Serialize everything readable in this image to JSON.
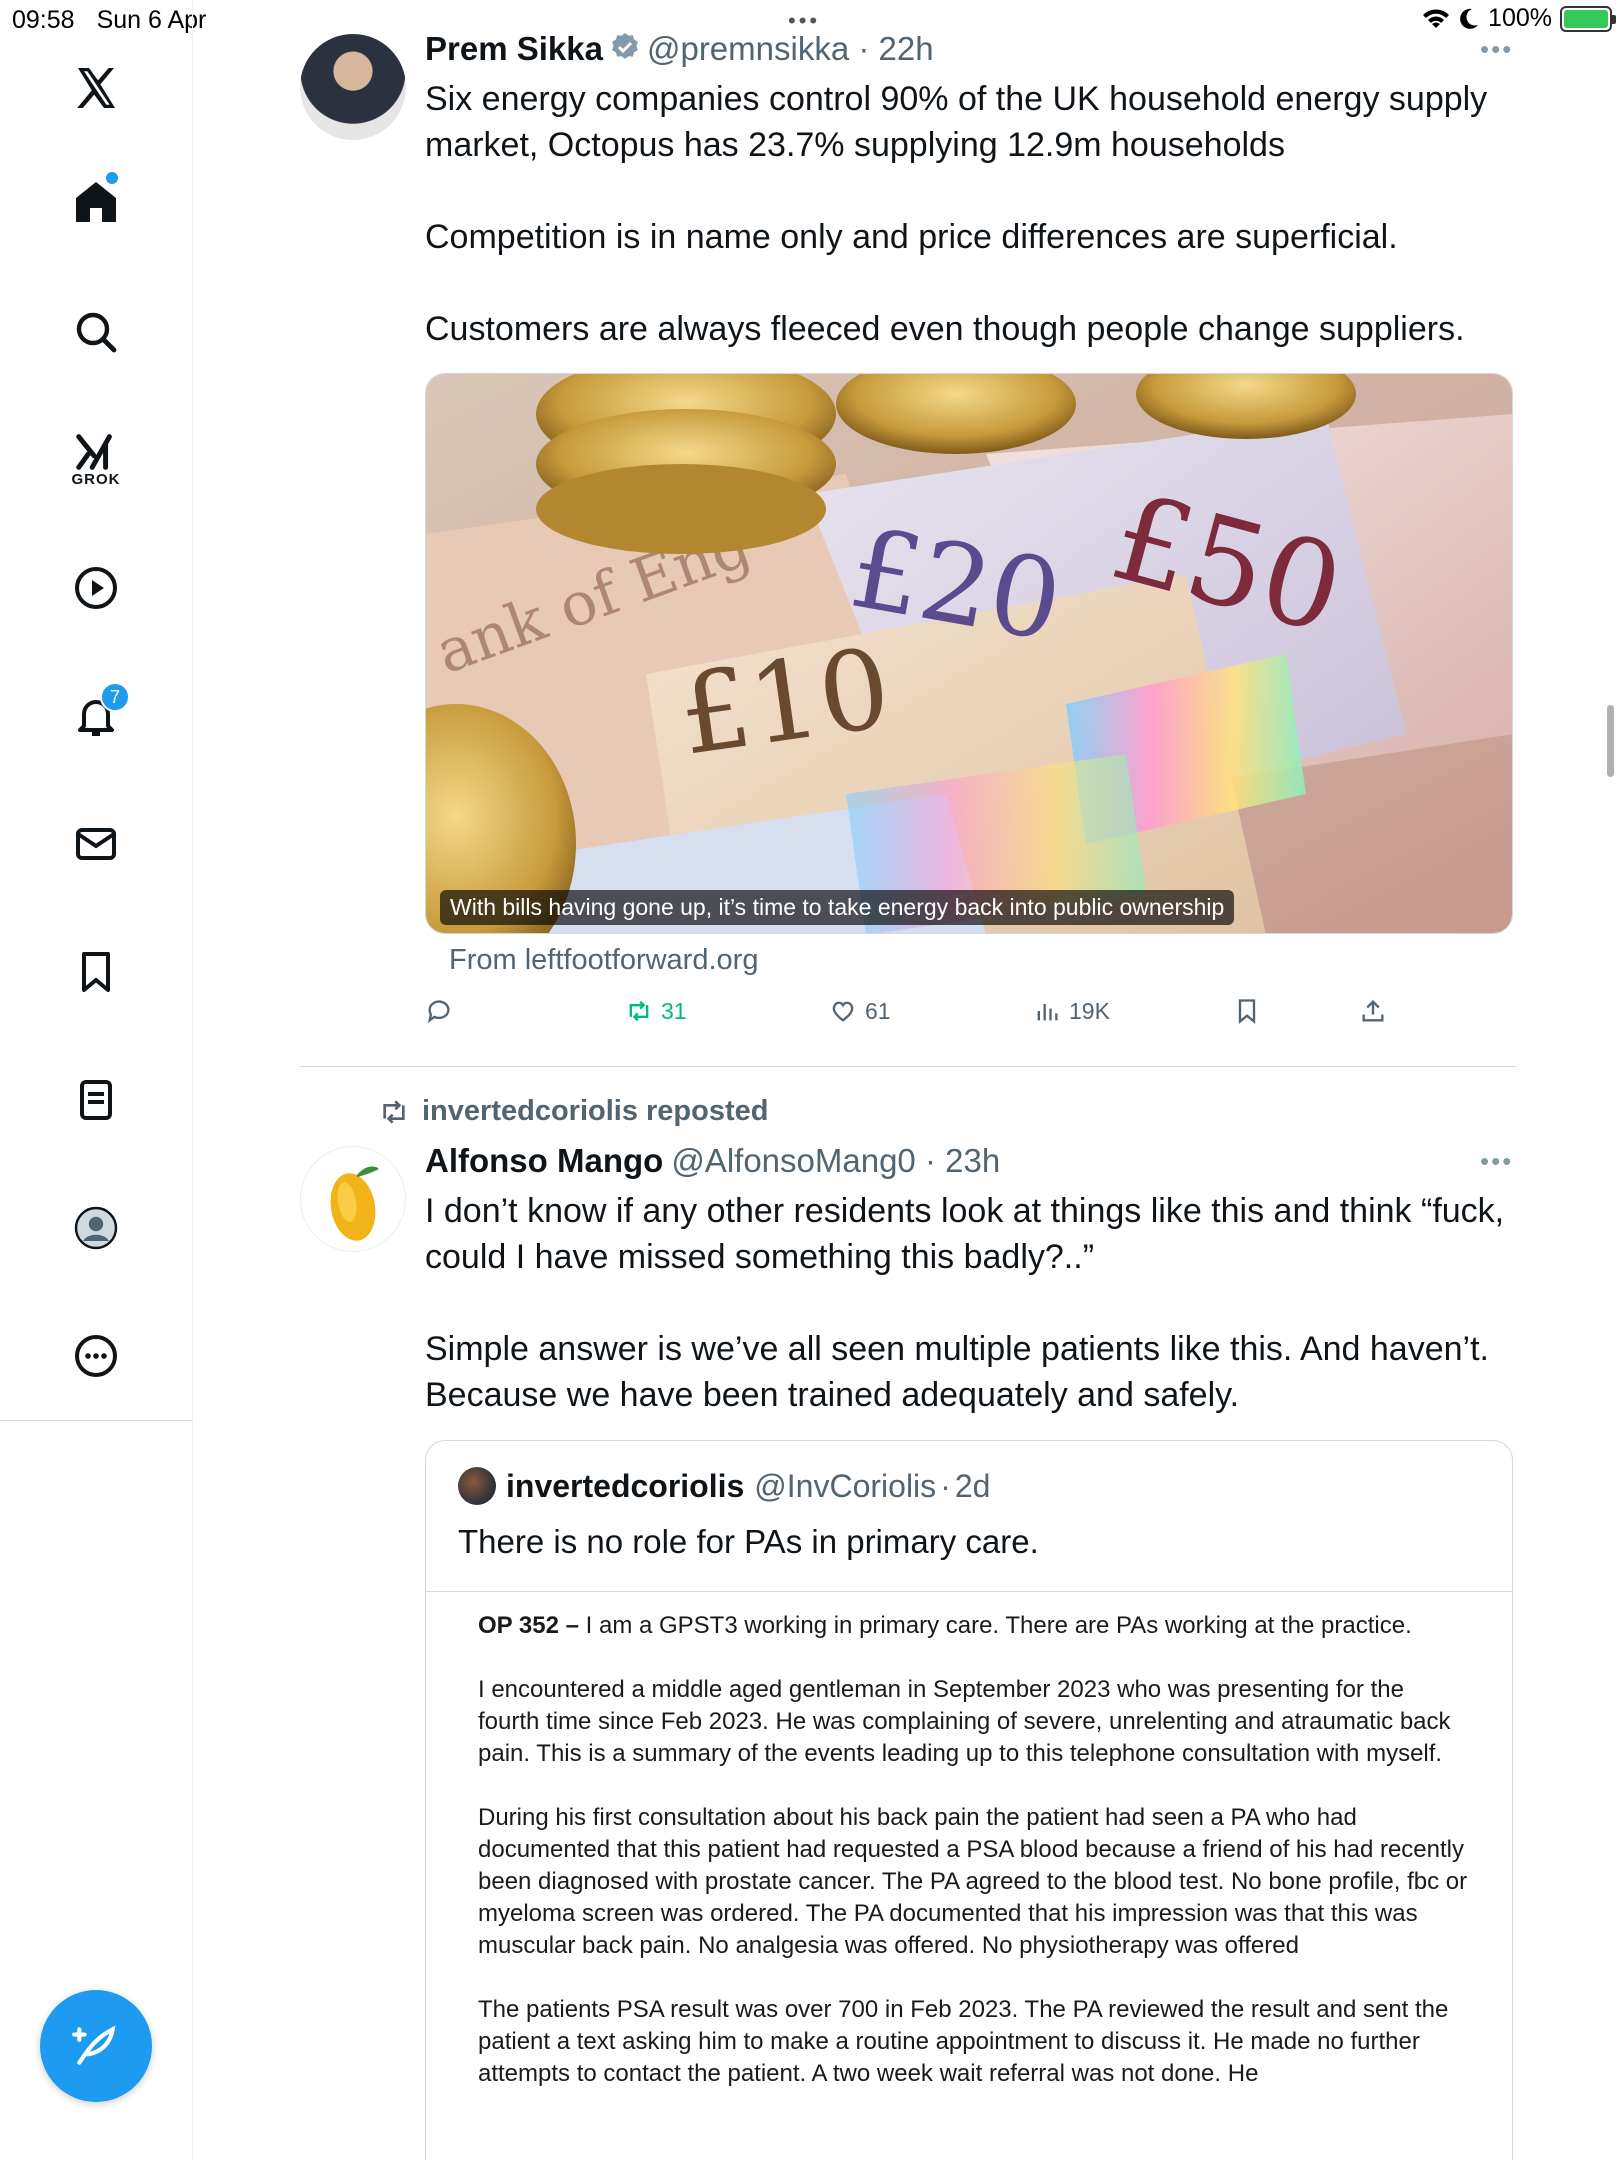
{
  "status_bar": {
    "time": "09:58",
    "date": "Sun 6 Apr",
    "battery": "100%"
  },
  "sidebar": {
    "grok_label": "GROK",
    "notifications_count": "7"
  },
  "tweet1": {
    "name": "Prem Sikka",
    "handle": "@premnsikka",
    "time": "22h",
    "paragraphs": [
      "Six energy companies control 90% of the UK household energy supply market, Octopus has 23.7% supplying 12.9m households",
      "Competition is in name only and price differences are superficial.",
      "Customers are always fleeced even though people change suppliers."
    ],
    "media_caption": "With bills having gone up, it’s time to take energy back into public ownership",
    "link_source": "From leftfootforward.org",
    "retweets": "31",
    "likes": "61",
    "views": "19K"
  },
  "tweet2": {
    "reposted_by": "invertedcoriolis reposted",
    "name": "Alfonso Mango",
    "handle": "@AlfonsoMang0",
    "time": "23h",
    "paragraphs": [
      "I don’t know if any other residents look at things like this and think “fuck, could I have missed something this badly?..”",
      "Simple answer is we’ve all seen multiple patients like this. And haven’t. Because we have been trained adequately and safely."
    ],
    "quote": {
      "name": "invertedcoriolis",
      "handle": "@InvCoriolis",
      "time": "2d",
      "text": "There is no role for PAs in primary care.",
      "doc_lead": "OP 352 –",
      "doc_lead_rest": " I am a GPST3 working in primary care. There are PAs working at the practice.",
      "doc_p2": "I encountered a middle aged gentleman in September 2023 who was presenting for the fourth time since Feb 2023. He was complaining of severe, unrelenting and atraumatic back pain. This is a summary of the events leading up to this telephone consultation with myself.",
      "doc_p3": "During his first consultation about his back pain the patient had seen a PA who had documented that this patient had requested a PSA blood because a friend of his had recently been diagnosed with prostate cancer. The PA agreed to the blood test. No bone profile, fbc or myeloma screen was ordered. The PA documented that his impression was that this was muscular back pain. No analgesia was offered. No physiotherapy was offered",
      "doc_p4": "The patients PSA result was over 700 in Feb 2023. The PA reviewed the result and sent the patient a text asking him to make a routine appointment to discuss it. He made no further attempts to contact the patient. A two week wait referral was not done. He"
    }
  },
  "colors": {
    "accent": "#1d9bf0",
    "repost_green": "#00ba7c",
    "muted": "#536471"
  }
}
